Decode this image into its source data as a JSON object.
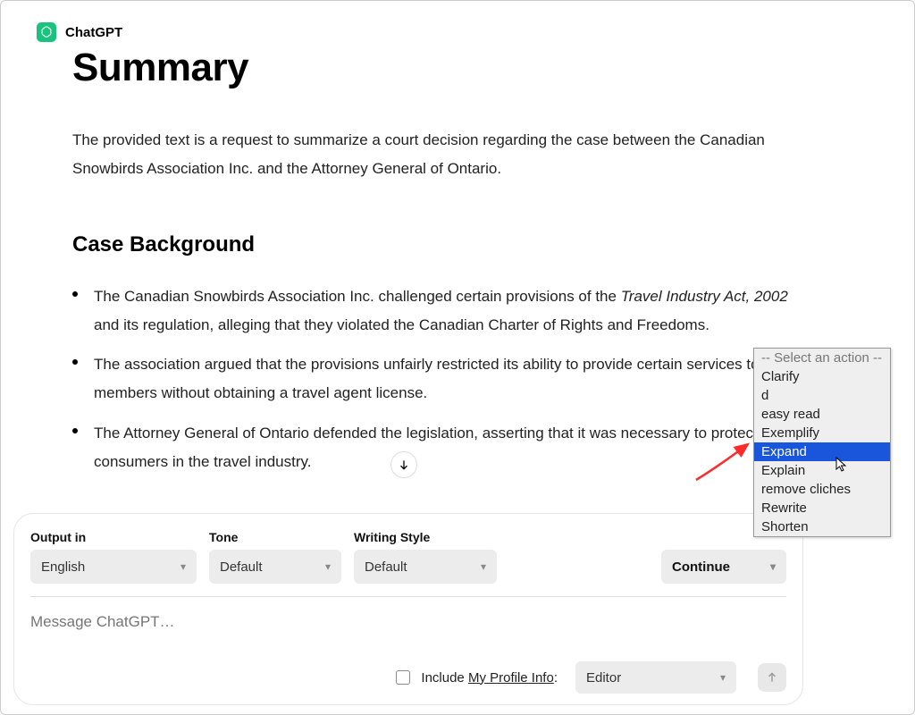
{
  "header": {
    "brand": "ChatGPT"
  },
  "title": "Summary",
  "intro": "The provided text is a request to summarize a court decision regarding the case between the Canadian Snowbirds Association Inc. and the Attorney General of Ontario.",
  "section_heading": "Case Background",
  "bullets": [
    {
      "pre": "The Canadian Snowbirds Association Inc. challenged certain provisions of the ",
      "italic": "Travel Industry Act, 2002",
      "post": " and its regulation, alleging that they violated the Canadian Charter of Rights and Freedoms."
    },
    {
      "pre": "The association argued that the provisions unfairly restricted its ability to provide certain services to its members without obtaining a travel agent license.",
      "italic": "",
      "post": ""
    },
    {
      "pre": "The Attorney General of Ontario defended the legislation, asserting that it was necessary to protect consumers in the travel industry.",
      "italic": "",
      "post": ""
    }
  ],
  "controls": {
    "output_label": "Output in",
    "output_value": "English",
    "tone_label": "Tone",
    "tone_value": "Default",
    "style_label": "Writing Style",
    "style_value": "Default",
    "continue_label": "Continue"
  },
  "message_placeholder": "Message ChatGPT…",
  "footer": {
    "include_prefix": "Include ",
    "include_link": "My Profile Info",
    "include_suffix": ":",
    "editor_value": "Editor"
  },
  "dropdown": {
    "header": "-- Select an action --",
    "items": [
      "Clarify",
      "d",
      "easy read",
      "Exemplify",
      "Expand",
      "Explain",
      "remove cliches",
      "Rewrite",
      "Shorten"
    ],
    "selected": "Expand"
  }
}
